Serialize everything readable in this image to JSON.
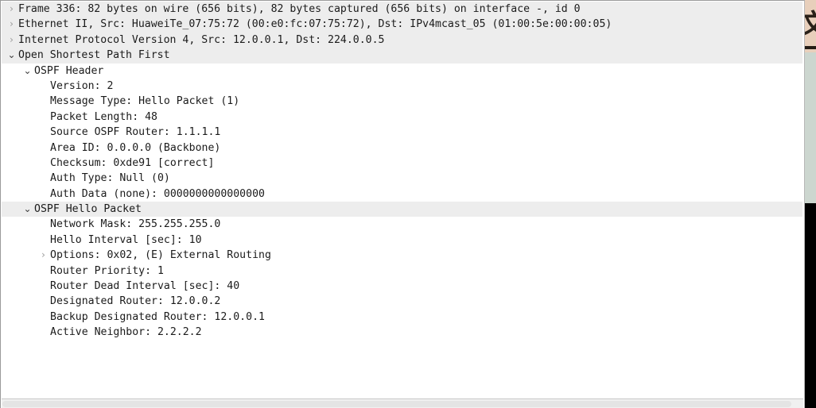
{
  "pane": {
    "name": "packet-details",
    "selected_background": "#ededed",
    "text_color": "#1b1b1b",
    "background": "#ffffff"
  },
  "tree": {
    "rows": [
      {
        "depth": 0,
        "state": "collapsed",
        "selected": true,
        "text": "Frame 336: 82 bytes on wire (656 bits), 82 bytes captured (656 bits) on interface -, id 0"
      },
      {
        "depth": 0,
        "state": "collapsed",
        "selected": true,
        "text": "Ethernet II, Src: HuaweiTe_07:75:72 (00:e0:fc:07:75:72), Dst: IPv4mcast_05 (01:00:5e:00:00:05)"
      },
      {
        "depth": 0,
        "state": "collapsed",
        "selected": true,
        "text": "Internet Protocol Version 4, Src: 12.0.0.1, Dst: 224.0.0.5"
      },
      {
        "depth": 0,
        "state": "expanded",
        "selected": true,
        "text": "Open Shortest Path First"
      },
      {
        "depth": 1,
        "state": "expanded",
        "selected": false,
        "text": "OSPF Header"
      },
      {
        "depth": 2,
        "state": "leaf",
        "selected": false,
        "text": "Version: 2"
      },
      {
        "depth": 2,
        "state": "leaf",
        "selected": false,
        "text": "Message Type: Hello Packet (1)"
      },
      {
        "depth": 2,
        "state": "leaf",
        "selected": false,
        "text": "Packet Length: 48"
      },
      {
        "depth": 2,
        "state": "leaf",
        "selected": false,
        "text": "Source OSPF Router: 1.1.1.1"
      },
      {
        "depth": 2,
        "state": "leaf",
        "selected": false,
        "text": "Area ID: 0.0.0.0 (Backbone)"
      },
      {
        "depth": 2,
        "state": "leaf",
        "selected": false,
        "text": "Checksum: 0xde91 [correct]"
      },
      {
        "depth": 2,
        "state": "leaf",
        "selected": false,
        "text": "Auth Type: Null (0)"
      },
      {
        "depth": 2,
        "state": "leaf",
        "selected": false,
        "text": "Auth Data (none): 0000000000000000"
      },
      {
        "depth": 1,
        "state": "expanded",
        "selected": true,
        "text": "OSPF Hello Packet"
      },
      {
        "depth": 2,
        "state": "leaf",
        "selected": false,
        "text": "Network Mask: 255.255.255.0"
      },
      {
        "depth": 2,
        "state": "leaf",
        "selected": false,
        "text": "Hello Interval [sec]: 10"
      },
      {
        "depth": 2,
        "state": "collapsed",
        "selected": false,
        "text": "Options: 0x02, (E) External Routing"
      },
      {
        "depth": 2,
        "state": "leaf",
        "selected": false,
        "text": "Router Priority: 1"
      },
      {
        "depth": 2,
        "state": "leaf",
        "selected": false,
        "text": "Router Dead Interval [sec]: 40"
      },
      {
        "depth": 2,
        "state": "leaf",
        "selected": false,
        "text": "Designated Router: 12.0.0.2"
      },
      {
        "depth": 2,
        "state": "leaf",
        "selected": false,
        "text": "Backup Designated Router: 12.0.0.1"
      },
      {
        "depth": 2,
        "state": "leaf",
        "selected": false,
        "text": "Active Neighbor: 2.2.2.2"
      }
    ]
  },
  "icons": {
    "collapsed": "›",
    "expanded": "⌄",
    "leaf": ""
  },
  "scrollbar": {
    "orientation": "horizontal",
    "name": "horizontal-scrollbar"
  }
}
